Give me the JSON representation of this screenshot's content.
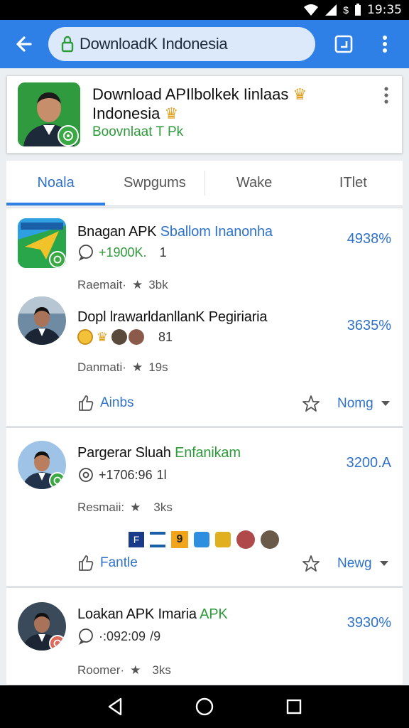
{
  "status_bar": {
    "time": "19:35"
  },
  "browser": {
    "url_text": "DownloadK Indonesia"
  },
  "header": {
    "title_line1": "Download APIlbolkek Iinlaas",
    "title_line2": "Indonesia",
    "subtitle": "Boovnlaat T Pk"
  },
  "tabs": [
    {
      "label": "Noala"
    },
    {
      "label": "Swpgums"
    },
    {
      "label": "Wake"
    },
    {
      "label": "ITlet"
    }
  ],
  "items": [
    {
      "title": "Bnagan APK",
      "title_hl": "Sballom Inanonha",
      "meta_prefix": "+1900K.",
      "meta_suffix": "1",
      "stat_label": "Raemait·",
      "stat_value": "3bk",
      "pct": "4938%"
    },
    {
      "title": "Dopl lrawarldanllanK",
      "title_hl": "Pegiriaria",
      "meta_suffix": "81",
      "stat_label": "Danmati·",
      "stat_value": "19s",
      "pct": "3635%"
    },
    {
      "title": "Pargerar Sluah",
      "title_hl": "Enfanikam",
      "meta_prefix": "+1706:96",
      "meta_suffix": "1l",
      "stat_label": "Resmaii:",
      "stat_value": "3ks",
      "pct": "3200.A"
    },
    {
      "title": "Loakan APK Imaria",
      "title_hl": "APK",
      "meta_prefix": "·:092:09",
      "meta_suffix": "/9",
      "stat_label": "Roomer·",
      "stat_value": "3ks",
      "pct": "3930%"
    }
  ],
  "actions": [
    {
      "left_label": "Ainbs",
      "right_label": "Nomg"
    },
    {
      "left_label": "Fantle",
      "right_label": "Newg"
    }
  ],
  "colors": {
    "accent": "#2f80e6",
    "link": "#2f72c8",
    "green": "#2e9a3a"
  }
}
